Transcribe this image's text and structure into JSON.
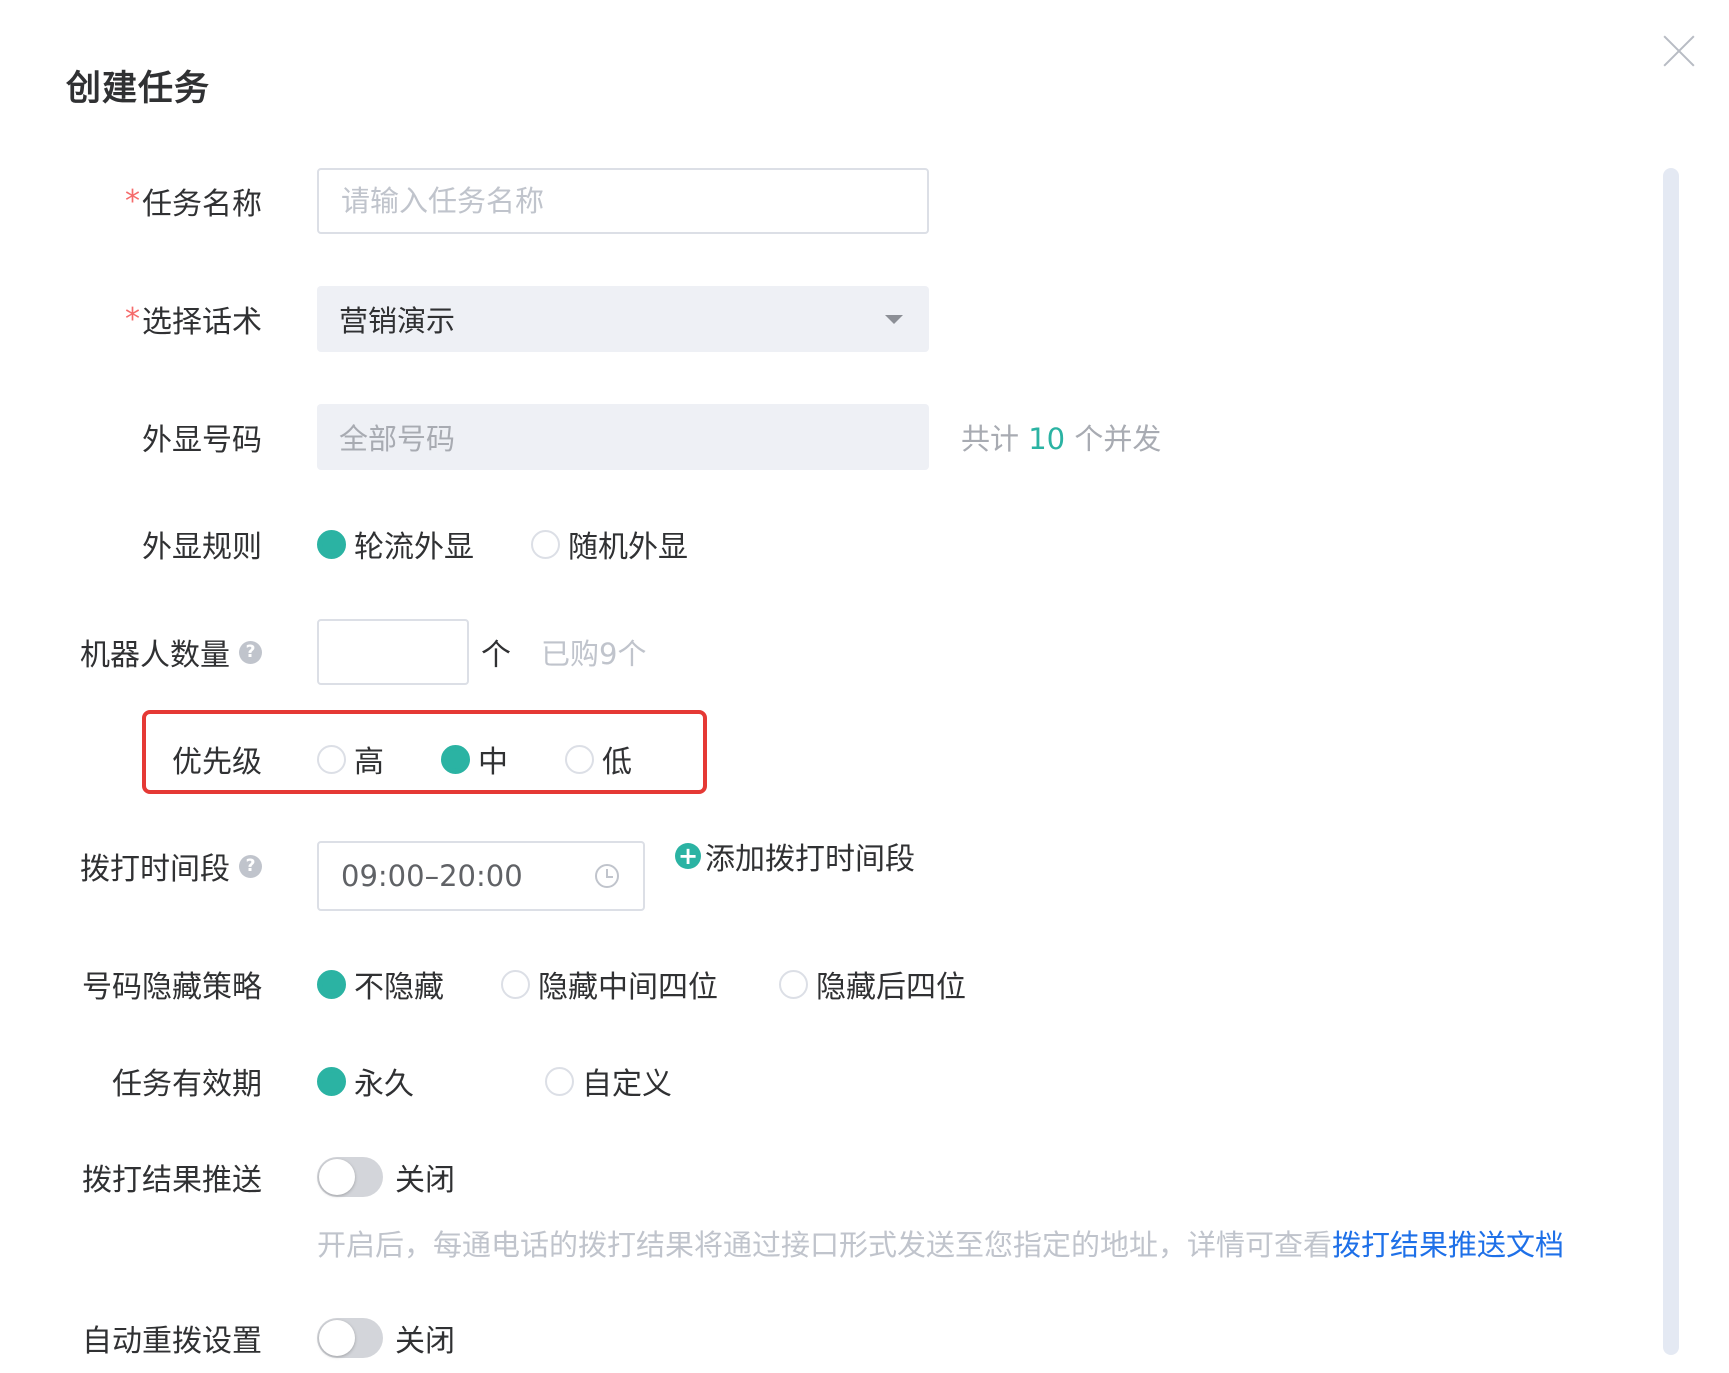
{
  "dialog": {
    "title": "创建任务",
    "close_label": "×"
  },
  "form": {
    "task_name": {
      "label": "任务名称",
      "required_mark": "*",
      "value": "",
      "placeholder": "请输入任务名称"
    },
    "script": {
      "label": "选择话术",
      "required_mark": "*",
      "value": "营销演示"
    },
    "caller_id": {
      "label": "外显号码",
      "value": "全部号码",
      "hint_prefix": "共计",
      "hint_count": "10",
      "hint_suffix": "个并发"
    },
    "caller_rule": {
      "label": "外显规则",
      "options": [
        "轮流外显",
        "随机外显"
      ],
      "selected": "轮流外显"
    },
    "robot_count": {
      "label": "机器人数量",
      "value": "",
      "unit": "个",
      "purchased": "已购9个"
    },
    "priority": {
      "label": "优先级",
      "options": [
        "高",
        "中",
        "低"
      ],
      "selected": "中"
    },
    "call_period": {
      "label": "拨打时间段",
      "value": "09:00–20:00",
      "add_label": "添加拨打时间段"
    },
    "number_hiding": {
      "label": "号码隐藏策略",
      "options": [
        "不隐藏",
        "隐藏中间四位",
        "隐藏后四位"
      ],
      "selected": "不隐藏"
    },
    "validity": {
      "label": "任务有效期",
      "options": [
        "永久",
        "自定义"
      ],
      "selected": "永久"
    },
    "result_push": {
      "label": "拨打结果推送",
      "state": "关闭",
      "description": "开启后，每通电话的拨打结果将通过接口形式发送至您指定的地址，详情可查看",
      "doc_link": "拨打结果推送文档"
    },
    "auto_redial": {
      "label": "自动重拨设置",
      "state": "关闭"
    }
  },
  "colors": {
    "accent": "#2bb3a3",
    "required": "#f56c6c",
    "highlight_box": "#e53935",
    "link": "#1e70e8"
  }
}
